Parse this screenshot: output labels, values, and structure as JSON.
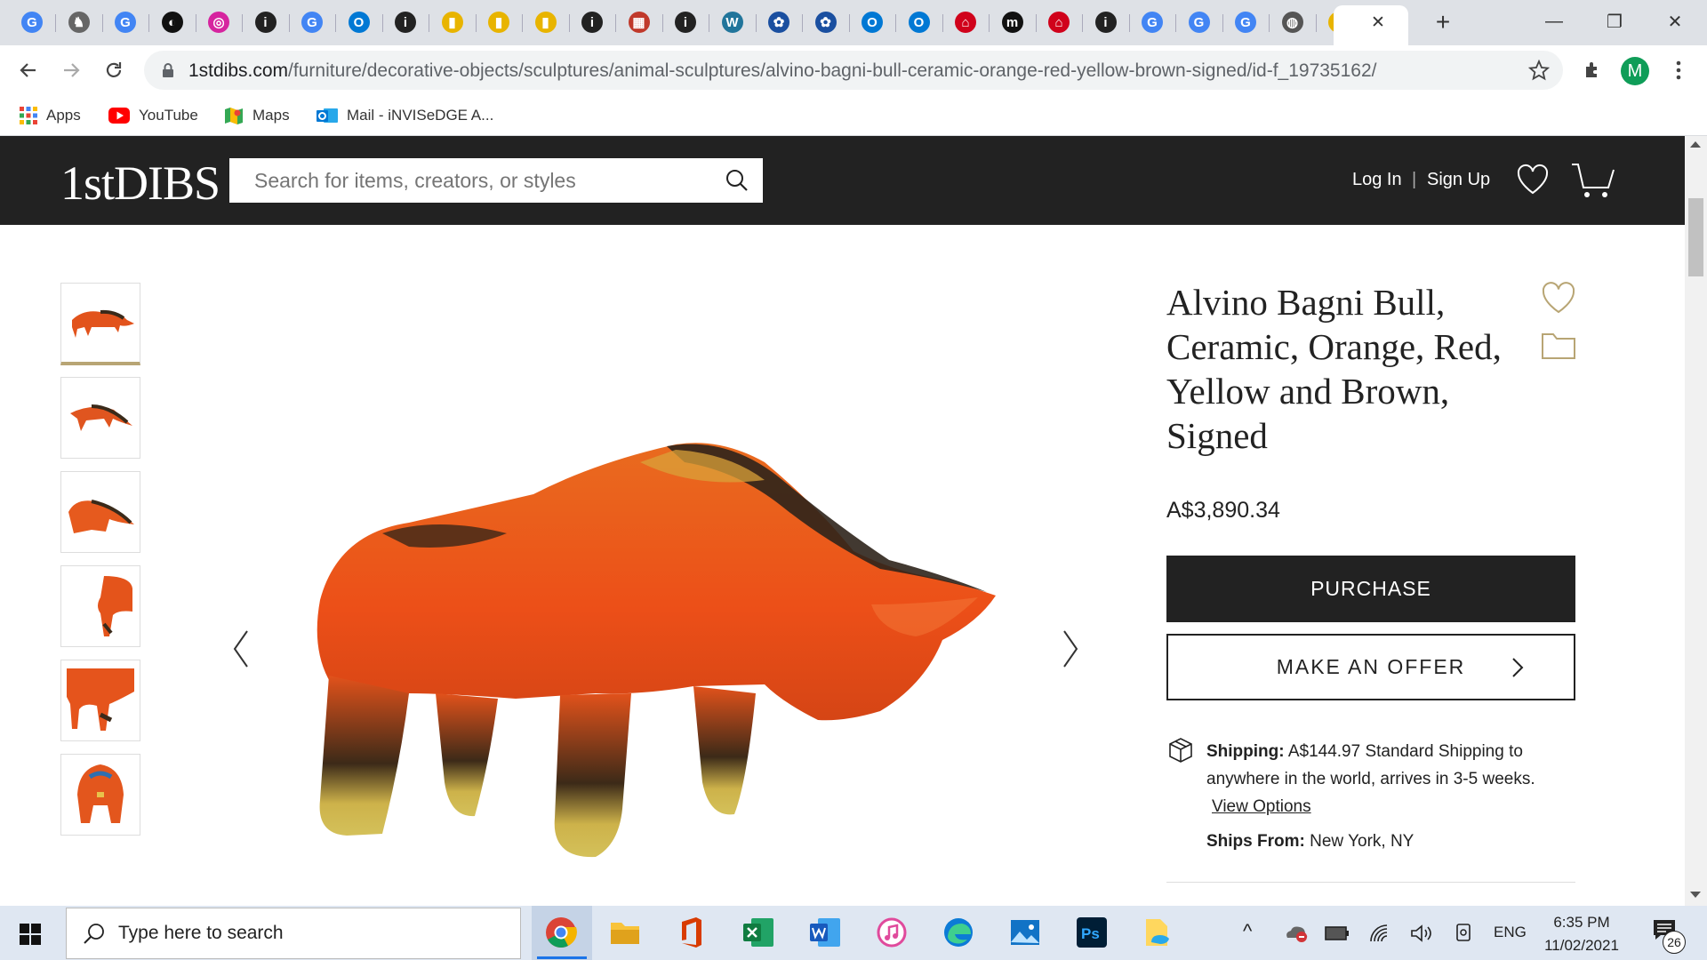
{
  "browser": {
    "tabs": [
      {
        "icon": "google-icon",
        "glyph": "G",
        "color": "#4285f4"
      },
      {
        "icon": "award-icon",
        "glyph": "♞",
        "color": "#666666"
      },
      {
        "icon": "google-icon",
        "glyph": "G",
        "color": "#4285f4"
      },
      {
        "icon": "podcast-icon",
        "glyph": "◐",
        "color": "#111111"
      },
      {
        "icon": "instagram-icon",
        "glyph": "◎",
        "color": "#d6249f"
      },
      {
        "icon": "info-icon",
        "glyph": "i",
        "color": "#222222"
      },
      {
        "icon": "google-icon",
        "glyph": "G",
        "color": "#4285f4"
      },
      {
        "icon": "outlook-icon",
        "glyph": "O",
        "color": "#0078d4"
      },
      {
        "icon": "info-icon",
        "glyph": "i",
        "color": "#222222"
      },
      {
        "icon": "shopping-bag-icon",
        "glyph": "▮",
        "color": "#e8b400"
      },
      {
        "icon": "shopping-bag-icon",
        "glyph": "▮",
        "color": "#e8b400"
      },
      {
        "icon": "shopping-bag-icon",
        "glyph": "▮",
        "color": "#e8b400"
      },
      {
        "icon": "info-icon",
        "glyph": "i",
        "color": "#222222"
      },
      {
        "icon": "calendar-icon",
        "glyph": "▦",
        "color": "#c0392b"
      },
      {
        "icon": "info-icon",
        "glyph": "i",
        "color": "#222222"
      },
      {
        "icon": "wordpress-icon",
        "glyph": "W",
        "color": "#21759b"
      },
      {
        "icon": "flower-icon",
        "glyph": "✿",
        "color": "#1a4fa0"
      },
      {
        "icon": "flower-icon",
        "glyph": "✿",
        "color": "#1a4fa0"
      },
      {
        "icon": "outlook-icon",
        "glyph": "O",
        "color": "#0078d4"
      },
      {
        "icon": "outlook-icon",
        "glyph": "O",
        "color": "#0078d4"
      },
      {
        "icon": "home-icon",
        "glyph": "⌂",
        "color": "#d0021b"
      },
      {
        "icon": "me-icon",
        "glyph": "m",
        "color": "#111111"
      },
      {
        "icon": "home-icon",
        "glyph": "⌂",
        "color": "#d0021b"
      },
      {
        "icon": "info-icon",
        "glyph": "i",
        "color": "#222222"
      },
      {
        "icon": "google-icon",
        "glyph": "G",
        "color": "#4285f4"
      },
      {
        "icon": "google-icon",
        "glyph": "G",
        "color": "#4285f4"
      },
      {
        "icon": "google-icon",
        "glyph": "G",
        "color": "#4285f4"
      },
      {
        "icon": "globe-icon",
        "glyph": "◍",
        "color": "#555555"
      },
      {
        "icon": "shopping-bag-icon",
        "glyph": "▮",
        "color": "#e8b400"
      }
    ],
    "active_tab_close": "✕",
    "new_tab": "+",
    "window_controls": [
      "—",
      "❐",
      "✕"
    ],
    "url_host": "1stdibs.com",
    "url_path": "/furniture/decorative-objects/sculptures/animal-sculptures/alvino-bagni-bull-ceramic-orange-red-yellow-brown-signed/id-f_19735162/",
    "profile_initial": "M",
    "bookmarks": [
      {
        "label": "Apps",
        "icon": "apps-grid-icon"
      },
      {
        "label": "YouTube",
        "icon": "youtube-icon"
      },
      {
        "label": "Maps",
        "icon": "maps-icon"
      },
      {
        "label": "Mail - iNVISeDGE A...",
        "icon": "outlook-icon"
      }
    ]
  },
  "site": {
    "logo": "1stDIBS",
    "search_placeholder": "Search for items, creators, or styles",
    "login": "Log In",
    "separator": "|",
    "signup": "Sign Up"
  },
  "product": {
    "title": "Alvino Bagni Bull, Ceramic, Orange, Red, Yellow and Brown, Signed",
    "price": "A$3,890.34",
    "purchase_label": "PURCHASE",
    "offer_label": "MAKE AN OFFER",
    "shipping_label": "Shipping:",
    "shipping_text": "A$144.97 Standard Shipping to anywhere in the world, arrives in 3-5 weeks.",
    "view_options": "View Options",
    "ships_from_label": "Ships From:",
    "ships_from": "New York, NY",
    "thumbnail_count": 6,
    "accent_color": "#b8a574"
  },
  "taskbar": {
    "search_placeholder": "Type here to search",
    "language": "ENG",
    "time": "6:35 PM",
    "date": "11/02/2021",
    "notifications": "26"
  }
}
